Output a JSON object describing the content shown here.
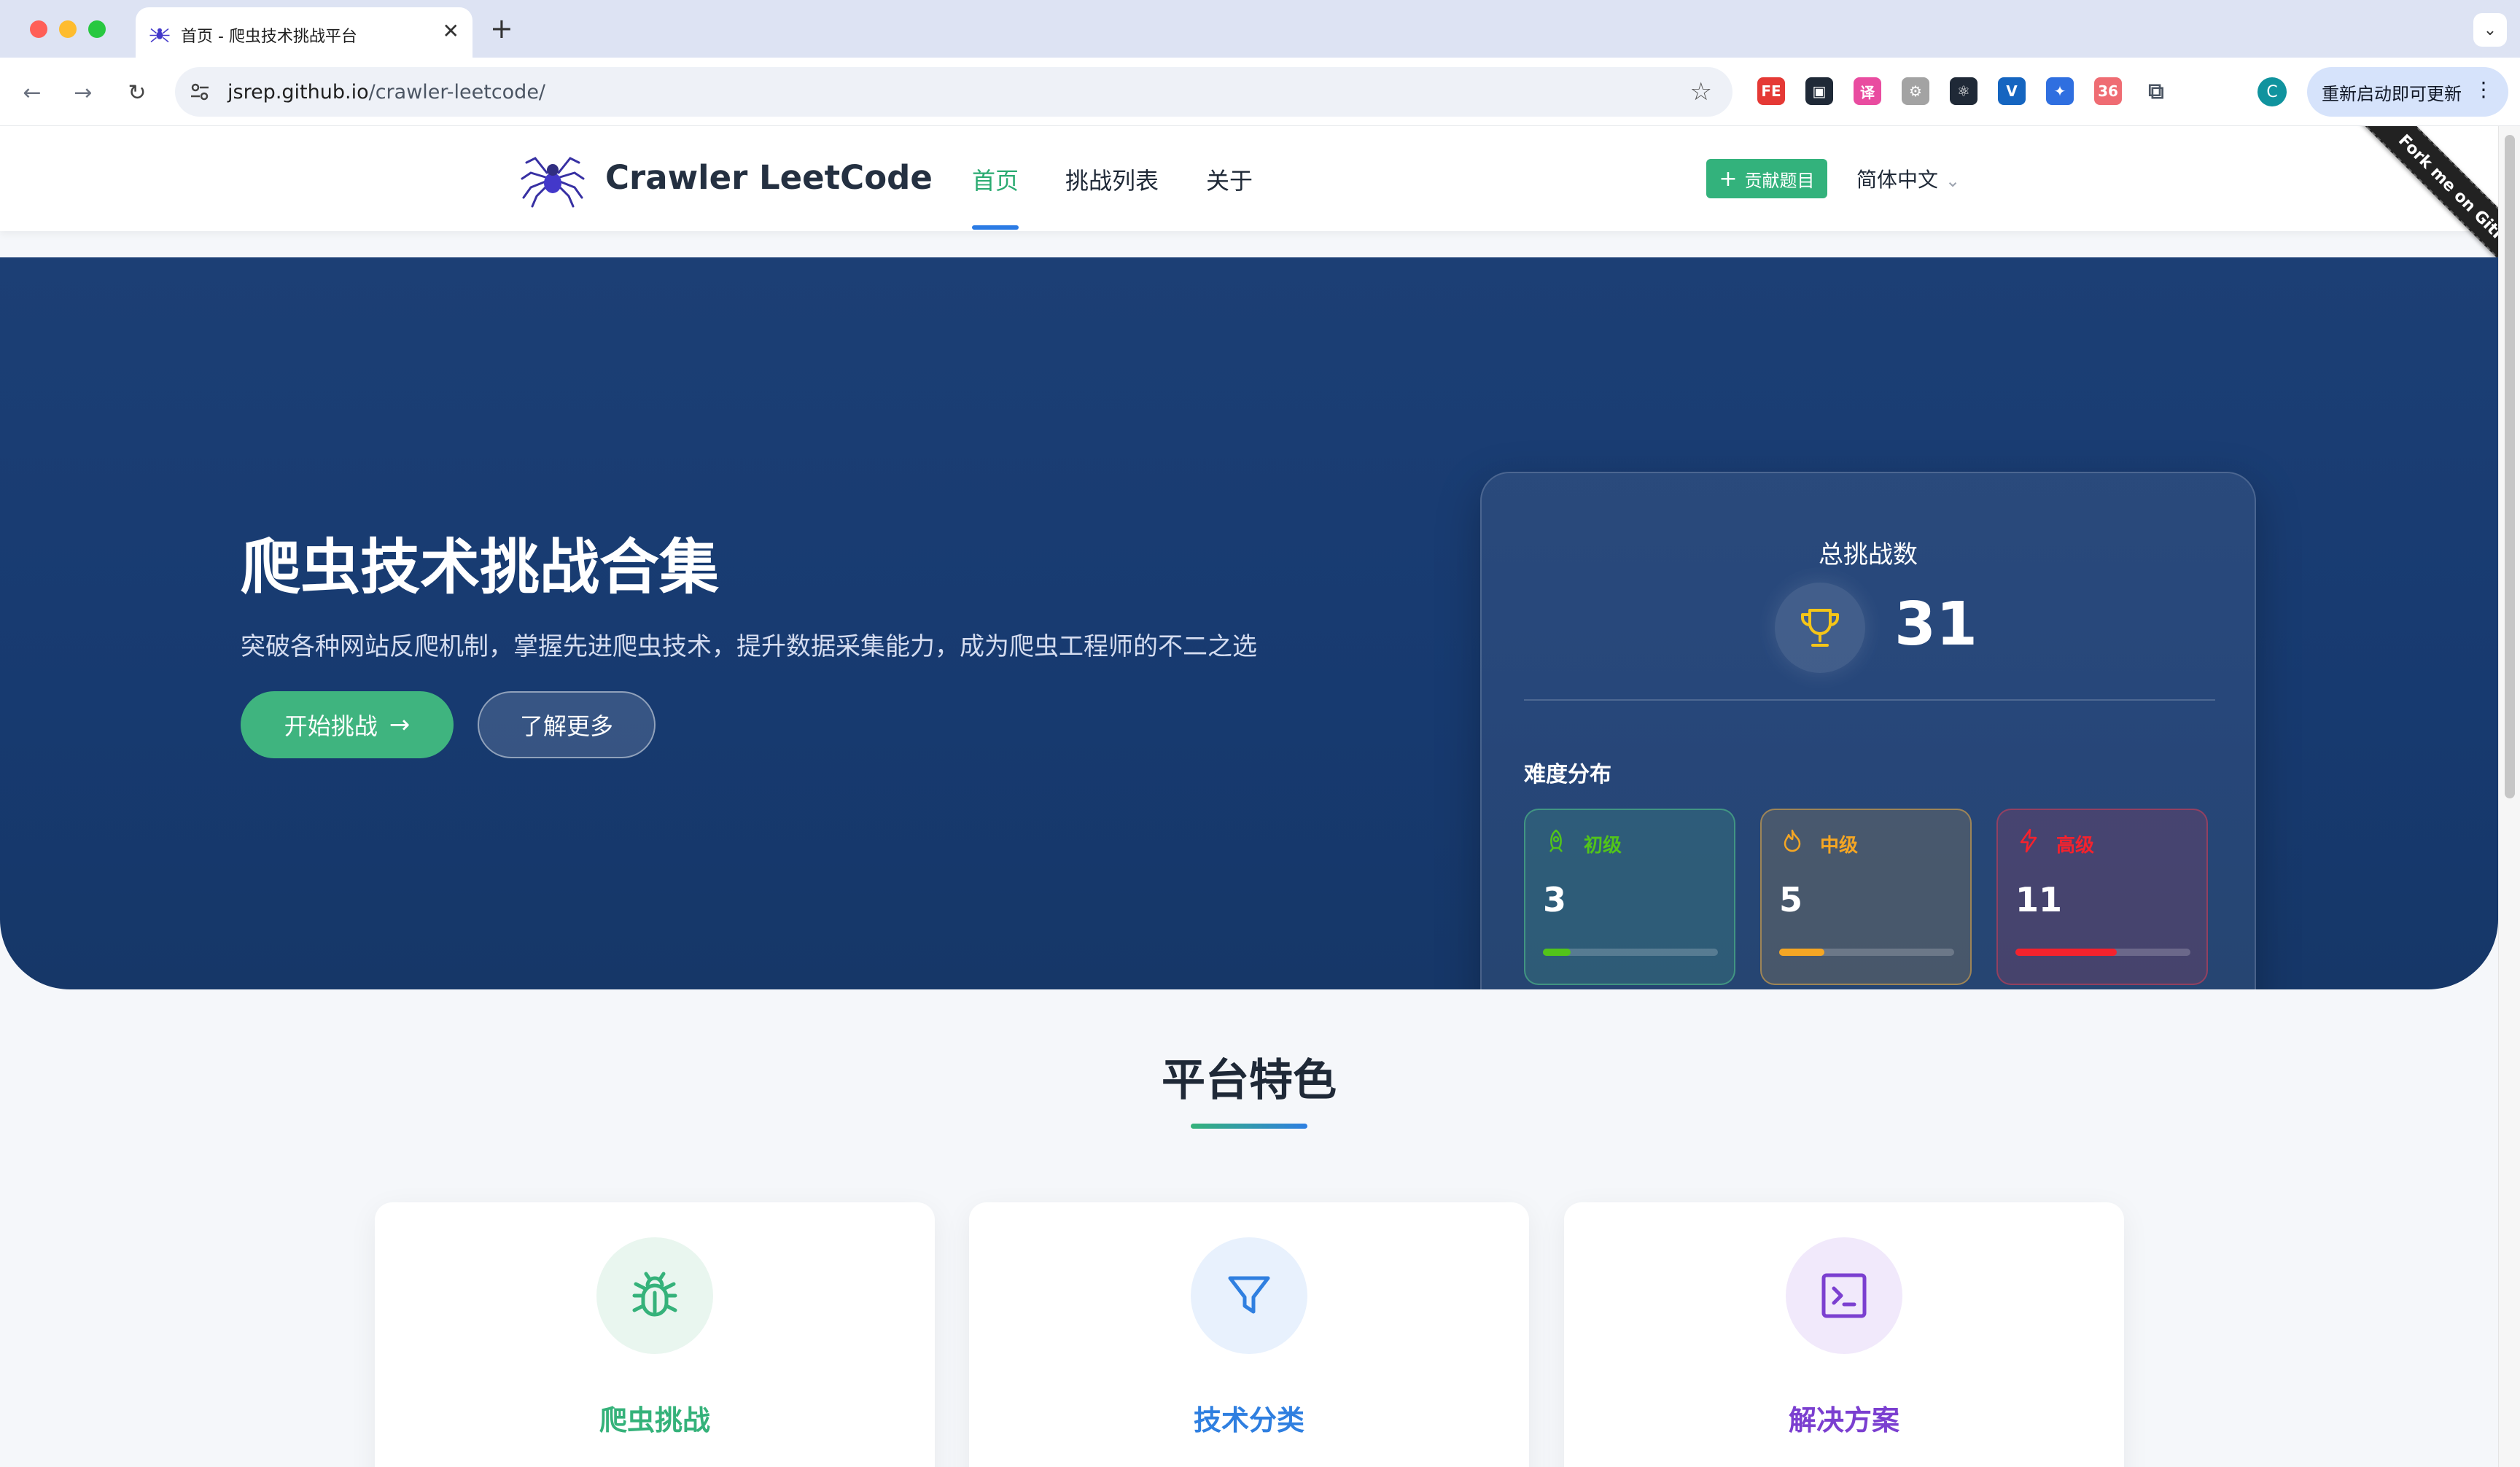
{
  "browser": {
    "tab_title": "首页 - 爬虫技术挑战平台",
    "url_host": "jsrep.github.io",
    "url_path": "/crawler-leetcode/",
    "profile_initial": "C",
    "update_label": "重新启动即可更新",
    "extensions": [
      {
        "icon": "fe-extension-icon",
        "text": "FE",
        "color": "#e53935"
      },
      {
        "icon": "devtools-extension-icon",
        "text": "▣",
        "color": "#1f2937"
      },
      {
        "icon": "translate-extension-icon",
        "text": "译",
        "color": "#e94ca0"
      },
      {
        "icon": "gear-extension-icon",
        "text": "⚙",
        "color": "#a3a3a3"
      },
      {
        "icon": "react-extension-icon",
        "text": "⚛",
        "color": "#1f2937"
      },
      {
        "icon": "vue-extension-icon",
        "text": "V",
        "color": "#1565c0"
      },
      {
        "icon": "puzzle-extension-icon",
        "text": "✦",
        "color": "#2f6fe0"
      },
      {
        "icon": "badge-extension-icon",
        "text": "36",
        "color": "#ef6c73"
      },
      {
        "icon": "extensions-menu-icon",
        "text": "⧉",
        "color": "#4b5563"
      }
    ]
  },
  "site": {
    "logo_text": "Crawler LeetCode",
    "nav": [
      "首页",
      "挑战列表",
      "关于"
    ],
    "contribute_label": "贡献题目",
    "language": "简体中文",
    "ribbon": "Fork me on GitHub"
  },
  "hero": {
    "title": "爬虫技术挑战合集",
    "subtitle": "突破各种网站反爬机制，掌握先进爬虫技术，提升数据采集能力，成为爬虫工程师的不二之选",
    "start_label": "开始挑战",
    "more_label": "了解更多"
  },
  "stats": {
    "total_label": "总挑战数",
    "total": "31",
    "distribution_label": "难度分布",
    "levels": [
      {
        "label": "初级",
        "count": "3",
        "fill_fraction": 0.16,
        "color": "#52c41a"
      },
      {
        "label": "中级",
        "count": "5",
        "fill_fraction": 0.26,
        "color": "#f5a623"
      },
      {
        "label": "高级",
        "count": "11",
        "fill_fraction": 0.58,
        "color": "#f5222d"
      }
    ]
  },
  "features": {
    "section_title": "平台特色",
    "cards": [
      {
        "title": "爬虫挑战",
        "icon": "bug-icon",
        "color": "#35b27a"
      },
      {
        "title": "技术分类",
        "icon": "filter-icon",
        "color": "#2f7fe0"
      },
      {
        "title": "解决方案",
        "icon": "terminal-icon",
        "color": "#7b3fd0"
      }
    ]
  }
}
